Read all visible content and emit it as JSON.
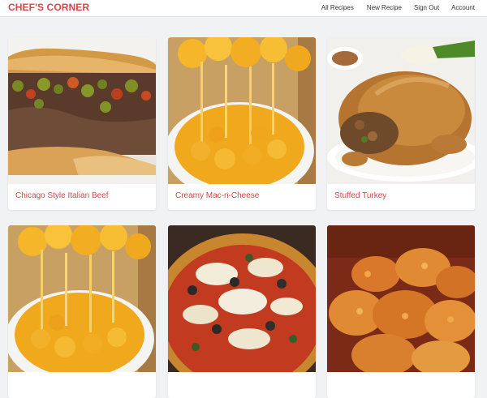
{
  "app": {
    "brand": "CHEF'S CORNER",
    "accent_color": "#d6454a"
  },
  "nav": {
    "all_recipes": "All Recipes",
    "new_recipe": "New Recipe",
    "sign_out": "Sign Out",
    "account": "Account"
  },
  "recipes": [
    {
      "title": "Chicago Style Italian Beef",
      "image": "italian-beef-sandwich"
    },
    {
      "title": "Creamy Mac-n-Cheese",
      "image": "mac-and-cheese-bowl"
    },
    {
      "title": "Stuffed Turkey",
      "image": "roast-stuffed-turkey"
    },
    {
      "title": "",
      "image": "mac-and-cheese-bowl"
    },
    {
      "title": "",
      "image": "pizza"
    },
    {
      "title": "",
      "image": "fried-chicken"
    }
  ]
}
